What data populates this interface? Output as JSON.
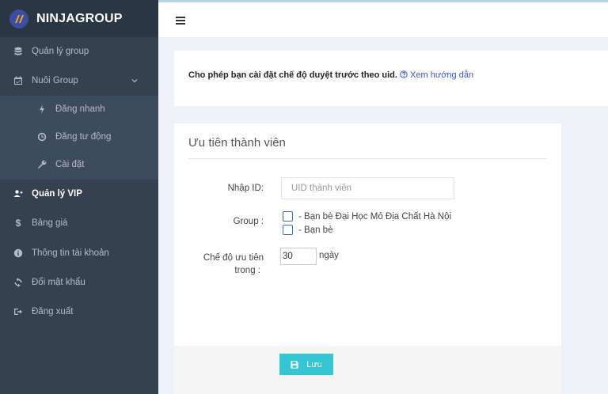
{
  "brand": {
    "name": "NINJAGROUP"
  },
  "sidebar": {
    "items": [
      {
        "label": "Quản lý group",
        "icon": "database-icon"
      },
      {
        "label": "Nuôi Group",
        "icon": "calendar-check-icon"
      },
      {
        "label": "Đăng nhanh",
        "icon": "bolt-icon"
      },
      {
        "label": "Đăng tư động",
        "icon": "clock-icon"
      },
      {
        "label": "Cài đặt",
        "icon": "wrench-icon"
      },
      {
        "label": "Quản lý VIP",
        "icon": "users-icon"
      },
      {
        "label": "Bảng giá",
        "icon": "dollar-icon"
      },
      {
        "label": "Thông tin tài khoản",
        "icon": "info-icon"
      },
      {
        "label": "Đổi mật khẩu",
        "icon": "refresh-icon"
      },
      {
        "label": "Đăng xuất",
        "icon": "sign-out-icon"
      }
    ]
  },
  "info": {
    "text": "Cho phép bạn cài đặt chế độ duyệt trước theo uid.",
    "link": "Xem hướng dẫn"
  },
  "form": {
    "title": "Ưu tiên thành viên",
    "uid_label": "Nhập ID:",
    "uid_placeholder": "UID thành viên",
    "group_label": "Group :",
    "group_options": [
      "- Bạn bè Đại Học Mỏ Địa Chất Hà Nội",
      "- Bạn bè"
    ],
    "priority_label_1": "Chế độ ưu tiên",
    "priority_label_2": "trong :",
    "priority_value": "30",
    "priority_unit": "ngày",
    "save_label": "Lưu"
  },
  "colors": {
    "sidebar_bg": "#364150",
    "brand_bg": "#2b3643",
    "accent": "#36c6d3",
    "link": "#3b55c8"
  }
}
